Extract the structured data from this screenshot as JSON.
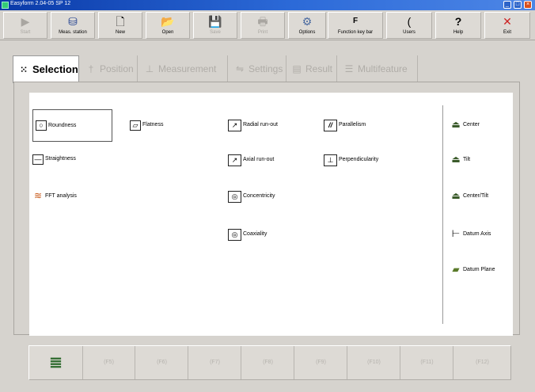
{
  "window": {
    "title": "Easyform 2.04-05 SP 12"
  },
  "toolbar": [
    {
      "label": "Start",
      "icon": "▶",
      "enabled": false
    },
    {
      "label": "Meas. station",
      "icon": "⛁",
      "enabled": true
    },
    {
      "label": "New",
      "icon": "🗋",
      "enabled": true
    },
    {
      "label": "Open",
      "icon": "📂",
      "enabled": true
    },
    {
      "label": "Save",
      "icon": "💾",
      "enabled": false
    },
    {
      "label": "Print",
      "icon": "🖶",
      "enabled": false
    },
    {
      "label": "Options",
      "icon": "⚙",
      "enabled": true
    },
    {
      "label": "Function key bar",
      "icon": "F",
      "enabled": true
    },
    {
      "label": "Users",
      "icon": "(",
      "enabled": true
    },
    {
      "label": "Help",
      "icon": "?",
      "enabled": true
    },
    {
      "label": "Exit",
      "icon": "✕",
      "enabled": true
    }
  ],
  "tabs": [
    {
      "label": "Selection",
      "icon": "⁙",
      "active": true
    },
    {
      "label": "Position",
      "icon": "†",
      "active": false
    },
    {
      "label": "Measurement",
      "icon": "⊥",
      "active": false
    },
    {
      "label": "Settings",
      "icon": "⇋",
      "active": false
    },
    {
      "label": "Result",
      "icon": "▤",
      "active": false
    },
    {
      "label": "Multifeature",
      "icon": "☰",
      "active": false
    }
  ],
  "features": {
    "roundness": {
      "label": "Roundness",
      "icon": "○"
    },
    "flatness": {
      "label": "Flatness",
      "icon": "▱"
    },
    "radial_runout": {
      "label": "Radial run-out",
      "icon": "↗"
    },
    "parallelism": {
      "label": "Parallelism",
      "icon": "//"
    },
    "straightness": {
      "label": "Straightness",
      "icon": "—"
    },
    "axial_runout": {
      "label": "Axial run-out",
      "icon": "↗"
    },
    "perpendicularity": {
      "label": "Perpendicularity",
      "icon": "⊥"
    },
    "fft_analysis": {
      "label": "FFT analysis",
      "icon": "≋"
    },
    "concentricity": {
      "label": "Concentricity",
      "icon": "◎"
    },
    "coaxiality": {
      "label": "Coaxiality",
      "icon": "◎"
    }
  },
  "alignment": {
    "center": {
      "label": "Center",
      "icon": "⏏"
    },
    "tilt": {
      "label": "Tilt",
      "icon": "⏏"
    },
    "center_tilt": {
      "label": "Center/Tilt",
      "icon": "⏏"
    },
    "datum_axis": {
      "label": "Datum Axis",
      "icon": "⊢"
    },
    "datum_plane": {
      "label": "Datum Plane",
      "icon": "▰"
    }
  },
  "function_keys": [
    "(F5)",
    "(F6)",
    "(F7)",
    "(F8)",
    "(F9)",
    "(F10)",
    "(F11)",
    "(F12)"
  ],
  "function_keys_first_icon": "≣"
}
